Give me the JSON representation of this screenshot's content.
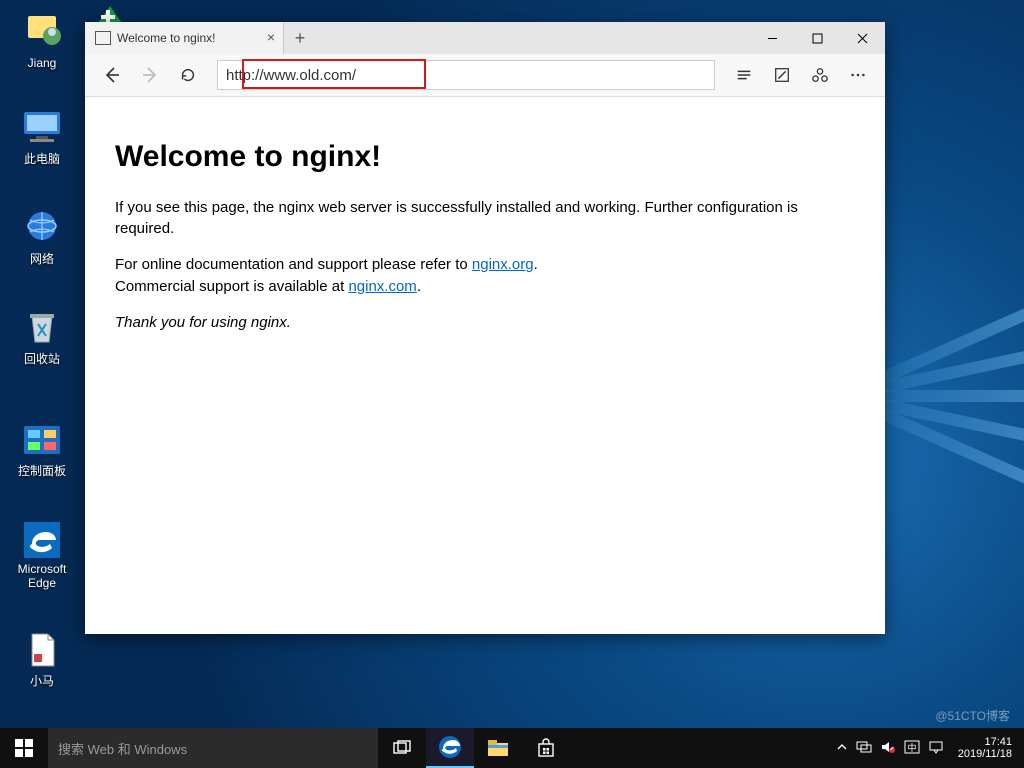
{
  "desktop_icons": [
    {
      "label": "Jiang"
    },
    {
      "label": "此电脑"
    },
    {
      "label": "网络"
    },
    {
      "label": "回收站"
    },
    {
      "label": "控制面板"
    },
    {
      "label": "Microsoft Edge"
    },
    {
      "label": "小马"
    }
  ],
  "browser": {
    "tab_title": "Welcome to nginx!",
    "url": "http://www.old.com/",
    "page": {
      "heading": "Welcome to nginx!",
      "p1": "If you see this page, the nginx web server is successfully installed and working. Further configuration is required.",
      "p2a": "For online documentation and support please refer to ",
      "link1": "nginx.org",
      "p2b": ".",
      "p3a": "Commercial support is available at ",
      "link2": "nginx.com",
      "p3b": ".",
      "thanks": "Thank you for using nginx."
    }
  },
  "taskbar": {
    "search_placeholder": "搜索 Web 和 Windows",
    "time": "17:41",
    "date": "2019/11/18"
  },
  "watermark": "@51CTO博客"
}
